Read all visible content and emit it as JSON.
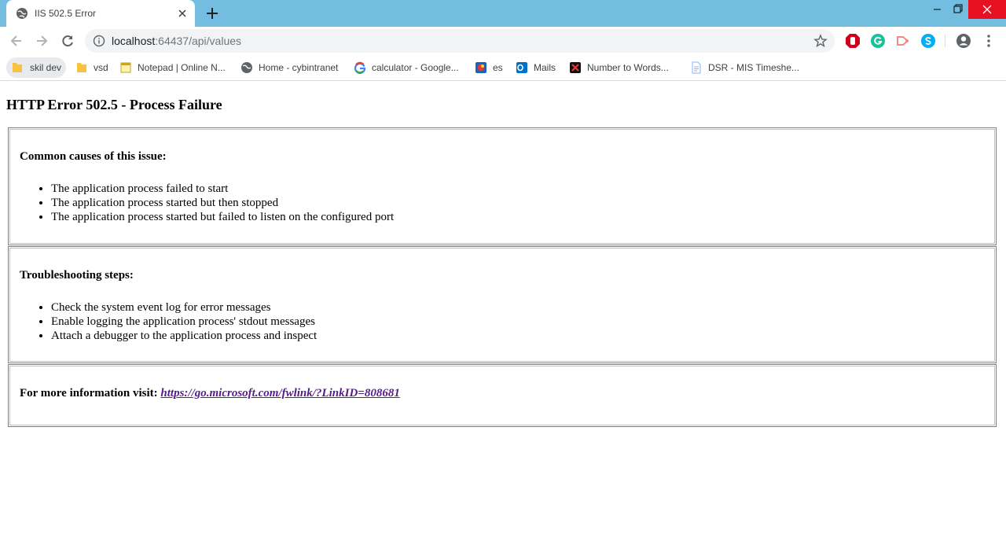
{
  "browser": {
    "tab": {
      "title": "IIS 502.5 Error"
    },
    "address": {
      "host": "localhost",
      "port_path": ":64437/api/values"
    },
    "bookmarks": [
      {
        "label": "skil dev",
        "icon": "folder-icon"
      },
      {
        "label": "vsd",
        "icon": "folder-icon"
      },
      {
        "label": "Notepad | Online N...",
        "icon": "notepad-icon"
      },
      {
        "label": "Home - cybintranet",
        "icon": "globe-icon"
      },
      {
        "label": "calculator - Google...",
        "icon": "google-icon"
      },
      {
        "label": "es",
        "icon": "es-icon"
      },
      {
        "label": "Mails",
        "icon": "outlook-icon"
      },
      {
        "label": "Number to Words...",
        "icon": "number-words-icon"
      },
      {
        "label": "DSR - MIS Timeshe...",
        "icon": "document-icon"
      }
    ],
    "colors": {
      "tabstrip": "#72bde0",
      "close_button": "#e81123",
      "link": "#551a8b"
    }
  },
  "page": {
    "title": "HTTP Error 502.5 - Process Failure",
    "causes": {
      "heading": "Common causes of this issue:",
      "items": [
        "The application process failed to start",
        "The application process started but then stopped",
        "The application process started but failed to listen on the configured port"
      ]
    },
    "troubleshooting": {
      "heading": "Troubleshooting steps:",
      "items": [
        "Check the system event log for error messages",
        "Enable logging the application process' stdout messages",
        "Attach a debugger to the application process and inspect"
      ]
    },
    "more_info": {
      "label": "For more information visit:",
      "link": "https://go.microsoft.com/fwlink/?LinkID=808681"
    }
  }
}
